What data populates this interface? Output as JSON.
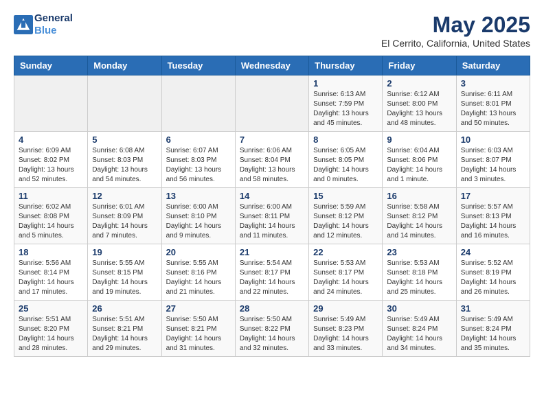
{
  "header": {
    "logo_line1": "General",
    "logo_line2": "Blue",
    "month_title": "May 2025",
    "location": "El Cerrito, California, United States"
  },
  "days_of_week": [
    "Sunday",
    "Monday",
    "Tuesday",
    "Wednesday",
    "Thursday",
    "Friday",
    "Saturday"
  ],
  "weeks": [
    [
      {
        "day": "",
        "info": ""
      },
      {
        "day": "",
        "info": ""
      },
      {
        "day": "",
        "info": ""
      },
      {
        "day": "",
        "info": ""
      },
      {
        "day": "1",
        "info": "Sunrise: 6:13 AM\nSunset: 7:59 PM\nDaylight: 13 hours\nand 45 minutes."
      },
      {
        "day": "2",
        "info": "Sunrise: 6:12 AM\nSunset: 8:00 PM\nDaylight: 13 hours\nand 48 minutes."
      },
      {
        "day": "3",
        "info": "Sunrise: 6:11 AM\nSunset: 8:01 PM\nDaylight: 13 hours\nand 50 minutes."
      }
    ],
    [
      {
        "day": "4",
        "info": "Sunrise: 6:09 AM\nSunset: 8:02 PM\nDaylight: 13 hours\nand 52 minutes."
      },
      {
        "day": "5",
        "info": "Sunrise: 6:08 AM\nSunset: 8:03 PM\nDaylight: 13 hours\nand 54 minutes."
      },
      {
        "day": "6",
        "info": "Sunrise: 6:07 AM\nSunset: 8:03 PM\nDaylight: 13 hours\nand 56 minutes."
      },
      {
        "day": "7",
        "info": "Sunrise: 6:06 AM\nSunset: 8:04 PM\nDaylight: 13 hours\nand 58 minutes."
      },
      {
        "day": "8",
        "info": "Sunrise: 6:05 AM\nSunset: 8:05 PM\nDaylight: 14 hours\nand 0 minutes."
      },
      {
        "day": "9",
        "info": "Sunrise: 6:04 AM\nSunset: 8:06 PM\nDaylight: 14 hours\nand 1 minute."
      },
      {
        "day": "10",
        "info": "Sunrise: 6:03 AM\nSunset: 8:07 PM\nDaylight: 14 hours\nand 3 minutes."
      }
    ],
    [
      {
        "day": "11",
        "info": "Sunrise: 6:02 AM\nSunset: 8:08 PM\nDaylight: 14 hours\nand 5 minutes."
      },
      {
        "day": "12",
        "info": "Sunrise: 6:01 AM\nSunset: 8:09 PM\nDaylight: 14 hours\nand 7 minutes."
      },
      {
        "day": "13",
        "info": "Sunrise: 6:00 AM\nSunset: 8:10 PM\nDaylight: 14 hours\nand 9 minutes."
      },
      {
        "day": "14",
        "info": "Sunrise: 6:00 AM\nSunset: 8:11 PM\nDaylight: 14 hours\nand 11 minutes."
      },
      {
        "day": "15",
        "info": "Sunrise: 5:59 AM\nSunset: 8:12 PM\nDaylight: 14 hours\nand 12 minutes."
      },
      {
        "day": "16",
        "info": "Sunrise: 5:58 AM\nSunset: 8:12 PM\nDaylight: 14 hours\nand 14 minutes."
      },
      {
        "day": "17",
        "info": "Sunrise: 5:57 AM\nSunset: 8:13 PM\nDaylight: 14 hours\nand 16 minutes."
      }
    ],
    [
      {
        "day": "18",
        "info": "Sunrise: 5:56 AM\nSunset: 8:14 PM\nDaylight: 14 hours\nand 17 minutes."
      },
      {
        "day": "19",
        "info": "Sunrise: 5:55 AM\nSunset: 8:15 PM\nDaylight: 14 hours\nand 19 minutes."
      },
      {
        "day": "20",
        "info": "Sunrise: 5:55 AM\nSunset: 8:16 PM\nDaylight: 14 hours\nand 21 minutes."
      },
      {
        "day": "21",
        "info": "Sunrise: 5:54 AM\nSunset: 8:17 PM\nDaylight: 14 hours\nand 22 minutes."
      },
      {
        "day": "22",
        "info": "Sunrise: 5:53 AM\nSunset: 8:17 PM\nDaylight: 14 hours\nand 24 minutes."
      },
      {
        "day": "23",
        "info": "Sunrise: 5:53 AM\nSunset: 8:18 PM\nDaylight: 14 hours\nand 25 minutes."
      },
      {
        "day": "24",
        "info": "Sunrise: 5:52 AM\nSunset: 8:19 PM\nDaylight: 14 hours\nand 26 minutes."
      }
    ],
    [
      {
        "day": "25",
        "info": "Sunrise: 5:51 AM\nSunset: 8:20 PM\nDaylight: 14 hours\nand 28 minutes."
      },
      {
        "day": "26",
        "info": "Sunrise: 5:51 AM\nSunset: 8:21 PM\nDaylight: 14 hours\nand 29 minutes."
      },
      {
        "day": "27",
        "info": "Sunrise: 5:50 AM\nSunset: 8:21 PM\nDaylight: 14 hours\nand 31 minutes."
      },
      {
        "day": "28",
        "info": "Sunrise: 5:50 AM\nSunset: 8:22 PM\nDaylight: 14 hours\nand 32 minutes."
      },
      {
        "day": "29",
        "info": "Sunrise: 5:49 AM\nSunset: 8:23 PM\nDaylight: 14 hours\nand 33 minutes."
      },
      {
        "day": "30",
        "info": "Sunrise: 5:49 AM\nSunset: 8:24 PM\nDaylight: 14 hours\nand 34 minutes."
      },
      {
        "day": "31",
        "info": "Sunrise: 5:49 AM\nSunset: 8:24 PM\nDaylight: 14 hours\nand 35 minutes."
      }
    ]
  ]
}
